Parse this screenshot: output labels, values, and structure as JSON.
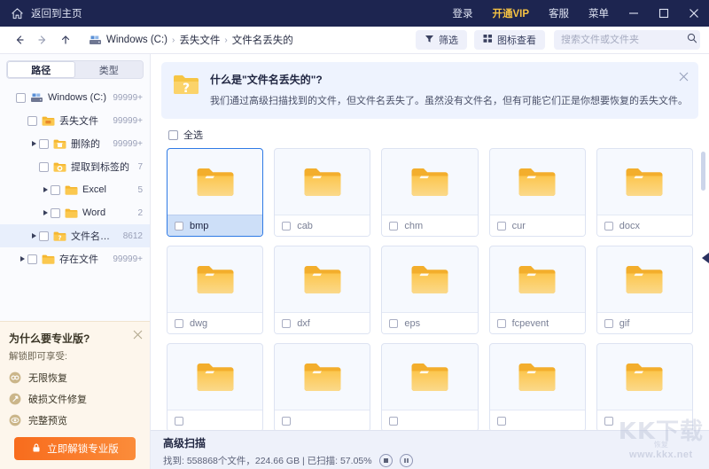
{
  "titlebar": {
    "home_label": "返回到主页",
    "home_icon": "home-icon",
    "links": [
      {
        "label": "登录",
        "name": "login"
      },
      {
        "label": "开通VIP",
        "name": "vip"
      },
      {
        "label": "客服",
        "name": "support"
      },
      {
        "label": "菜单",
        "name": "menu"
      }
    ],
    "minimize": "minimize-icon",
    "maximize": "maximize-icon",
    "close": "close-icon",
    "bg_color": "#1d2550",
    "vip_color": "#f6c343"
  },
  "toolbar": {
    "back": "back-arrow-icon",
    "forward": "forward-arrow-icon",
    "up": "up-arrow-icon",
    "drive_icon": "drive-icon",
    "breadcrumbs": [
      "Windows (C:)",
      "丢失文件",
      "文件名丢失的"
    ],
    "separator": "›",
    "filter_label": "筛选",
    "filter_icon": "filter-icon",
    "view_label": "图标查看",
    "view_icon": "grid-view-icon",
    "search_placeholder": "搜索文件或文件夹",
    "search_value": "",
    "search_icon": "search-icon"
  },
  "sidebar": {
    "tabs": [
      {
        "label": "路径",
        "active": true
      },
      {
        "label": "类型",
        "active": false
      }
    ],
    "tree": [
      {
        "label": "Windows (C:)",
        "count": "99999+",
        "indent": 0,
        "caret": "down",
        "icon": "drive-icon",
        "selected": false
      },
      {
        "label": "丢失文件",
        "count": "99999+",
        "indent": 1,
        "caret": "down",
        "icon": "lost-folder-icon",
        "selected": false
      },
      {
        "label": "删除的",
        "count": "99999+",
        "indent": 2,
        "caret": "right",
        "icon": "trash-folder-icon",
        "selected": false
      },
      {
        "label": "提取到标签的",
        "count": "7",
        "indent": 2,
        "caret": "down",
        "icon": "tag-folder-icon",
        "selected": false
      },
      {
        "label": "Excel",
        "count": "5",
        "indent": 3,
        "caret": "right",
        "icon": "folder-icon",
        "selected": false
      },
      {
        "label": "Word",
        "count": "2",
        "indent": 3,
        "caret": "right",
        "icon": "folder-icon",
        "selected": false
      },
      {
        "label": "文件名丢失的",
        "count": "8612",
        "indent": 2,
        "caret": "right",
        "icon": "question-folder-icon",
        "selected": true
      },
      {
        "label": "存在文件",
        "count": "99999+",
        "indent": 1,
        "caret": "right",
        "icon": "folder-icon",
        "selected": false
      }
    ]
  },
  "promo": {
    "title": "为什么要专业版?",
    "subtitle": "解锁即可享受:",
    "close_icon": "close-icon",
    "features": [
      {
        "label": "无限恢复",
        "icon": "infinity-icon"
      },
      {
        "label": "破损文件修复",
        "icon": "repair-icon"
      },
      {
        "label": "完整预览",
        "icon": "eye-icon"
      }
    ],
    "button_label": "立即解锁专业版",
    "button_icon": "lock-icon",
    "button_color": "#f86c1d"
  },
  "notice": {
    "icon": "question-folder-icon",
    "title": "什么是\"文件名丢失的\"?",
    "text": "我们通过高级扫描找到的文件，但文件名丢失了。虽然没有文件名，但有可能它们正是你想要恢复的丢失文件。",
    "close_icon": "close-icon"
  },
  "content": {
    "select_all_label": "全选",
    "select_all_checked": false,
    "folders": [
      {
        "label": "bmp",
        "selected": true
      },
      {
        "label": "cab",
        "selected": false
      },
      {
        "label": "chm",
        "selected": false
      },
      {
        "label": "cur",
        "selected": false
      },
      {
        "label": "docx",
        "selected": false
      },
      {
        "label": "dwg",
        "selected": false
      },
      {
        "label": "dxf",
        "selected": false
      },
      {
        "label": "eps",
        "selected": false
      },
      {
        "label": "fcpevent",
        "selected": false
      },
      {
        "label": "gif",
        "selected": false
      },
      {
        "label": "",
        "selected": false
      },
      {
        "label": "",
        "selected": false
      },
      {
        "label": "",
        "selected": false
      },
      {
        "label": "",
        "selected": false
      },
      {
        "label": "",
        "selected": false
      }
    ]
  },
  "statusbar": {
    "title": "高级扫描",
    "detail": "找到: 558868个文件，224.66 GB | 已扫描: 57.05%",
    "stop_icon": "stop-icon",
    "pause_icon": "pause-icon"
  },
  "watermark": {
    "main": "KK下载",
    "sub": "恢复",
    "url": "www.kkx.net"
  }
}
